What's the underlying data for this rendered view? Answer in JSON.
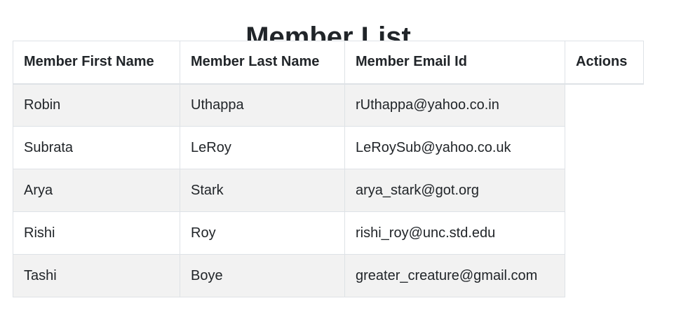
{
  "page": {
    "title": "Member List"
  },
  "table": {
    "headers": {
      "first_name": "Member First Name",
      "last_name": "Member Last Name",
      "email": "Member Email Id",
      "actions": "Actions"
    },
    "rows": [
      {
        "first_name": "Robin",
        "last_name": "Uthappa",
        "email": "rUthappa@yahoo.co.in"
      },
      {
        "first_name": "Subrata",
        "last_name": "LeRoy",
        "email": "LeRoySub@yahoo.co.uk"
      },
      {
        "first_name": "Arya",
        "last_name": "Stark",
        "email": "arya_stark@got.org"
      },
      {
        "first_name": "Rishi",
        "last_name": "Roy",
        "email": "rishi_roy@unc.std.edu"
      },
      {
        "first_name": "Tashi",
        "last_name": "Boye",
        "email": "greater_creature@gmail.com"
      }
    ]
  },
  "colors": {
    "text": "#212529",
    "border": "#dee2e6",
    "striped_row": "#f2f2f2"
  }
}
